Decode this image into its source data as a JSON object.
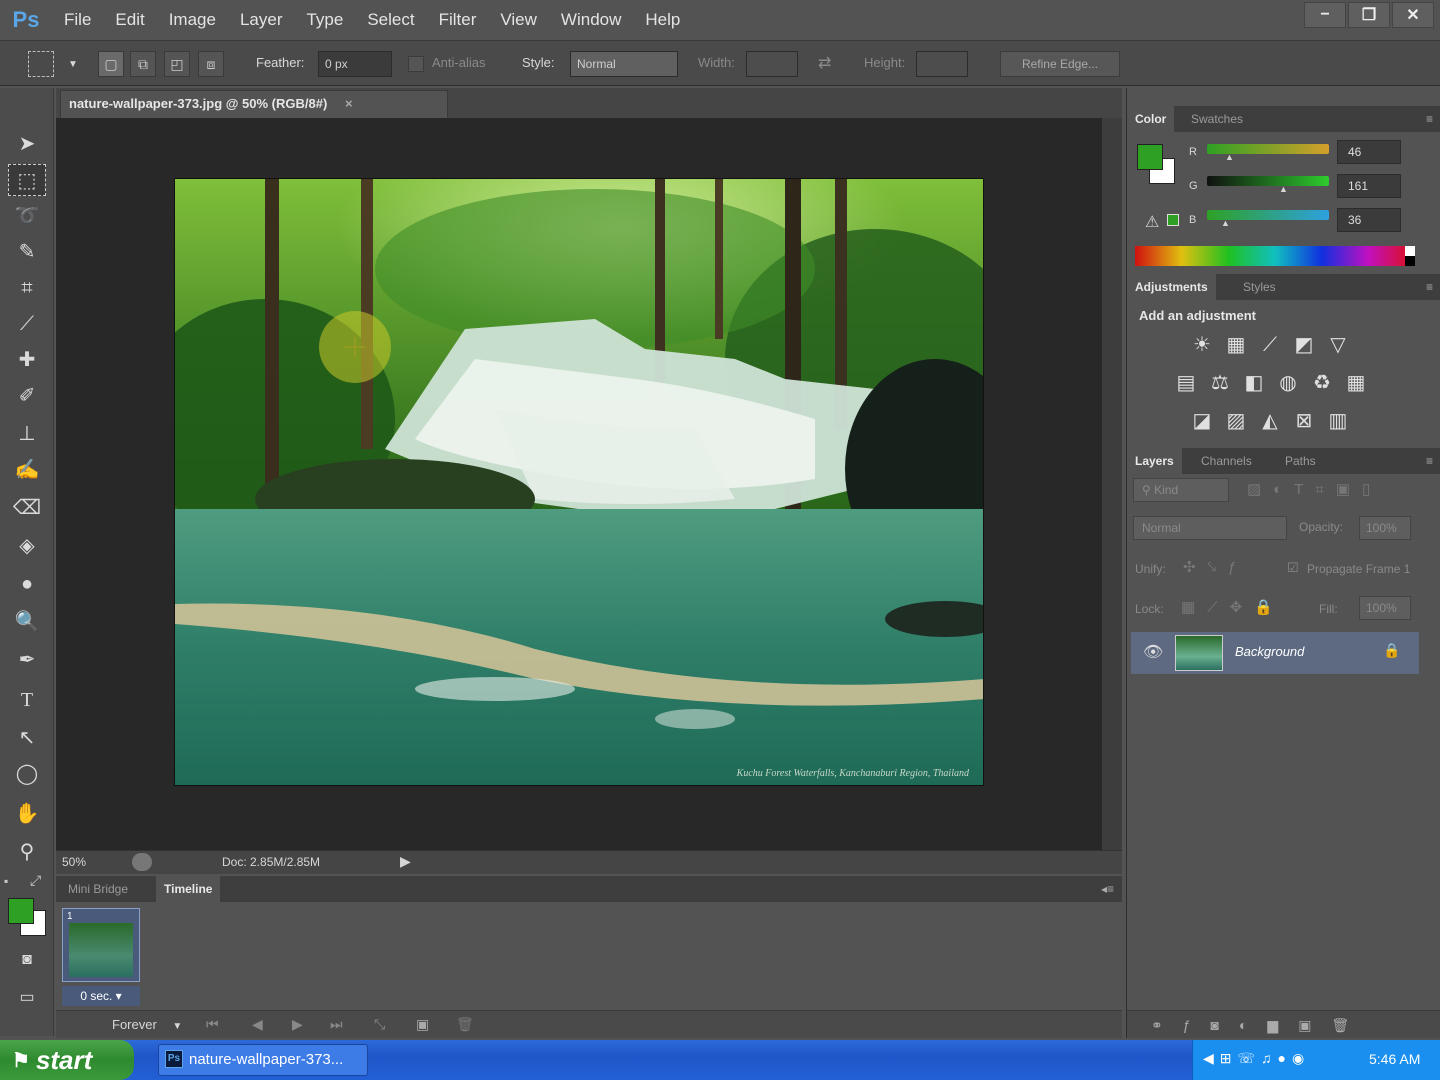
{
  "app": {
    "logo": "Ps"
  },
  "menu": [
    "File",
    "Edit",
    "Image",
    "Layer",
    "Type",
    "Select",
    "Filter",
    "View",
    "Window",
    "Help"
  ],
  "window_controls": {
    "minimize": "−",
    "restore": "❐",
    "close": "✕"
  },
  "options": {
    "feather_label": "Feather:",
    "feather_value": "0 px",
    "antialias_label": "Anti-alias",
    "style_label": "Style:",
    "style_value": "Normal",
    "width_label": "Width:",
    "height_label": "Height:",
    "refine_edge": "Refine Edge..."
  },
  "document": {
    "tab_title": "nature-wallpaper-373.jpg @ 50% (RGB/8#)",
    "close": "×",
    "caption": "Kuchu Forest Waterfalls, Kanchanaburi Region, Thailand"
  },
  "status": {
    "zoom": "50%",
    "doc": "Doc: 2.85M/2.85M"
  },
  "timeline": {
    "tabs": [
      "Mini Bridge",
      "Timeline"
    ],
    "frame_number": "1",
    "frame_delay": "0 sec.",
    "loop": "Forever"
  },
  "color_panel": {
    "tabs": [
      "Color",
      "Swatches"
    ],
    "r_label": "R",
    "g_label": "G",
    "b_label": "B",
    "r_value": "46",
    "g_value": "161",
    "b_value": "36",
    "fg_color": "#2ea124",
    "bg_color": "#ffffff"
  },
  "adjustments_panel": {
    "tabs": [
      "Adjustments",
      "Styles"
    ],
    "heading": "Add an adjustment"
  },
  "layers_panel": {
    "tabs": [
      "Layers",
      "Channels",
      "Paths"
    ],
    "filter_kind": "Kind",
    "blend_mode": "Normal",
    "opacity_label": "Opacity:",
    "opacity_value": "100%",
    "unify_label": "Unify:",
    "propagate_label": "Propagate Frame 1",
    "lock_label": "Lock:",
    "fill_label": "Fill:",
    "fill_value": "100%",
    "layer_name": "Background"
  },
  "taskbar": {
    "start": "start",
    "task": "nature-wallpaper-373...",
    "clock": "5:46 AM"
  }
}
